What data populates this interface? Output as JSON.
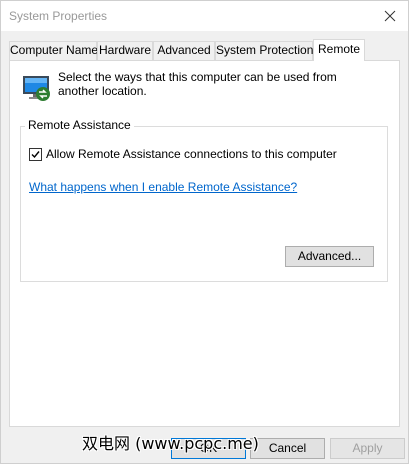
{
  "window": {
    "title": "System Properties"
  },
  "tabs": [
    {
      "label": "Computer Name"
    },
    {
      "label": "Hardware"
    },
    {
      "label": "Advanced"
    },
    {
      "label": "System Protection"
    },
    {
      "label": "Remote",
      "active": true
    }
  ],
  "remote": {
    "description": "Select the ways that this computer can be used from another location.",
    "group_title": "Remote Assistance",
    "allow_label": "Allow Remote Assistance connections to this computer",
    "allow_checked": true,
    "help_link": "What happens when I enable Remote Assistance?",
    "advanced_button": "Advanced..."
  },
  "footer": {
    "ok": "OK",
    "cancel": "Cancel",
    "apply": "Apply"
  },
  "watermark": "双电网 (www.pcpc.me)",
  "colors": {
    "link": "#0066cc",
    "accent": "#0078d7",
    "panel": "#ffffff",
    "chrome": "#f0f0f0"
  }
}
